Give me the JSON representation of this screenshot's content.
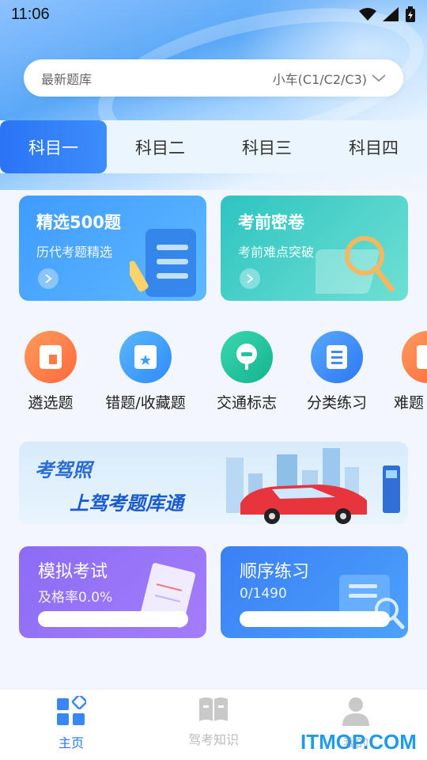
{
  "status_bar": {
    "time": "11:06"
  },
  "search": {
    "placeholder": "最新题库",
    "car_type": "小车(C1/C2/C3)"
  },
  "subject_tabs": [
    {
      "label": "科目一",
      "active": true
    },
    {
      "label": "科目二",
      "active": false
    },
    {
      "label": "科目三",
      "active": false
    },
    {
      "label": "科目四",
      "active": false
    }
  ],
  "feature_cards": [
    {
      "title": "精选500题",
      "subtitle": "历代考题精选"
    },
    {
      "title": "考前密卷",
      "subtitle": "考前难点突破"
    }
  ],
  "functions": [
    {
      "label": "遴选题",
      "icon": "book-icon",
      "color": "#ff7a45"
    },
    {
      "label": "错题/收藏题",
      "icon": "star-doc-icon",
      "color": "#3aa0ff"
    },
    {
      "label": "交通标志",
      "icon": "traffic-sign-icon",
      "color": "#22c5a0"
    },
    {
      "label": "分类练习",
      "icon": "list-icon",
      "color": "#3a8cf8"
    },
    {
      "label": "难题",
      "icon": "doc-icon",
      "color": "#ff7a45"
    }
  ],
  "banner": {
    "line1": "考驾照",
    "line2": "上驾考题库通"
  },
  "practice_cards": [
    {
      "title": "模拟考试",
      "subtitle": "及格率0.0%"
    },
    {
      "title": "顺序练习",
      "subtitle": "0/1490"
    }
  ],
  "nav": [
    {
      "label": "主页",
      "active": true
    },
    {
      "label": "驾考知识",
      "active": false
    },
    {
      "label": "我的",
      "active": false
    }
  ],
  "watermark": "ITMOP.COM"
}
